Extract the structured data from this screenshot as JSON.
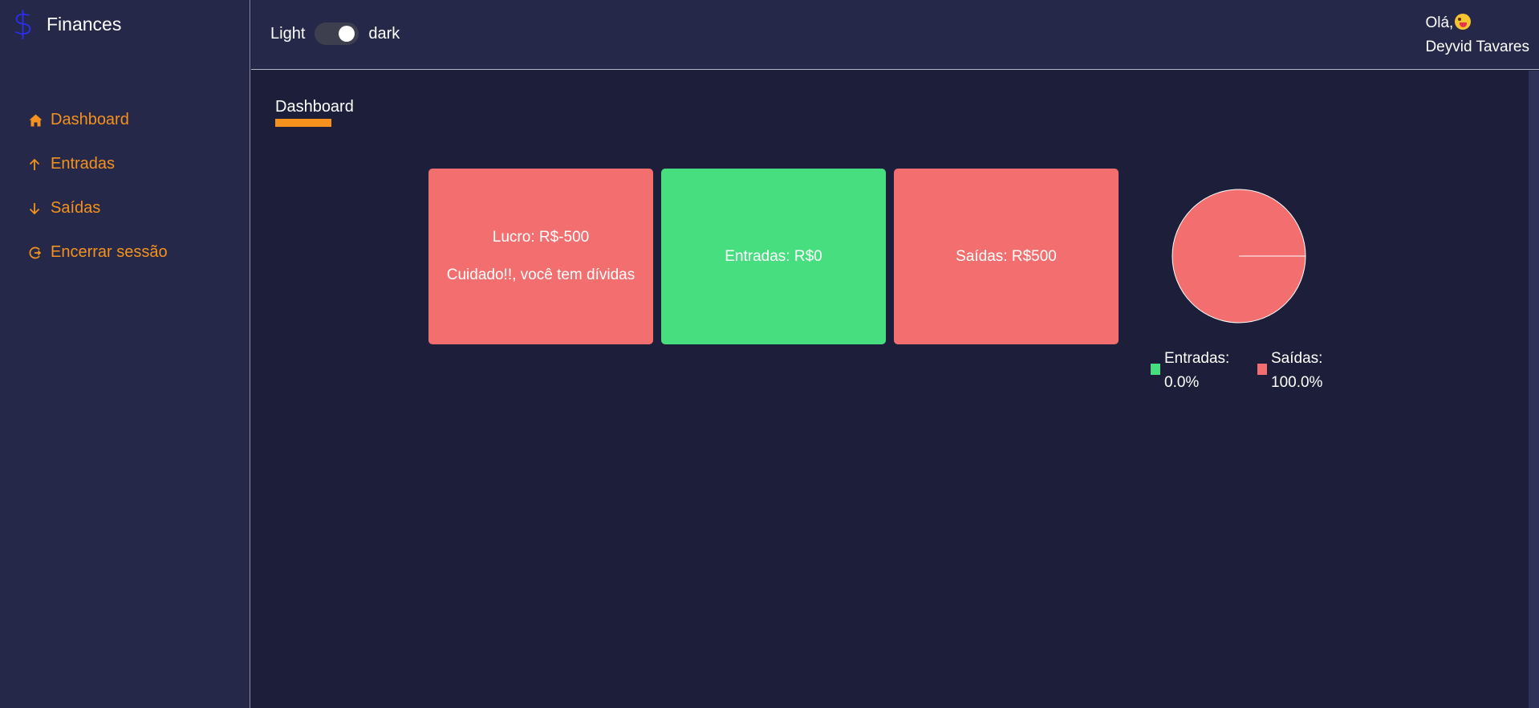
{
  "brand": {
    "icon": "dollar-icon",
    "name": "Finances",
    "icon_color": "#2b2ff2"
  },
  "sidebar": {
    "items": [
      {
        "label": "Dashboard",
        "icon": "home-icon"
      },
      {
        "label": "Entradas",
        "icon": "arrow-up-icon"
      },
      {
        "label": "Saídas",
        "icon": "arrow-down-icon"
      },
      {
        "label": "Encerrar sessão",
        "icon": "logout-icon"
      }
    ],
    "accent": "#f5921d"
  },
  "header": {
    "theme_light_label": "Light",
    "theme_dark_label": "dark",
    "theme_is_dark": true,
    "greeting": "Olá,",
    "greeting_emoji": "tongue-wink-emoji",
    "user_name": "Deyvid Tavares"
  },
  "main": {
    "page_title": "Dashboard",
    "cards": {
      "lucro": {
        "line1": "Lucro: R$-500",
        "line2": "Cuidado!!, você tem dívidas",
        "color": "#f36f6f"
      },
      "entradas": {
        "label": "Entradas: R$0",
        "color": "#47de80"
      },
      "saidas": {
        "label": "Saídas: R$500",
        "color": "#f36f6f"
      }
    }
  },
  "chart_data": {
    "type": "pie",
    "slices": [
      {
        "label": "Entradas:",
        "value": 0.0,
        "percent_label": "0.0%",
        "color": "#47de80"
      },
      {
        "label": "Saídas:",
        "value": 100.0,
        "percent_label": "100.0%",
        "color": "#f36f6f"
      }
    ],
    "legend_placement": "bottom"
  }
}
